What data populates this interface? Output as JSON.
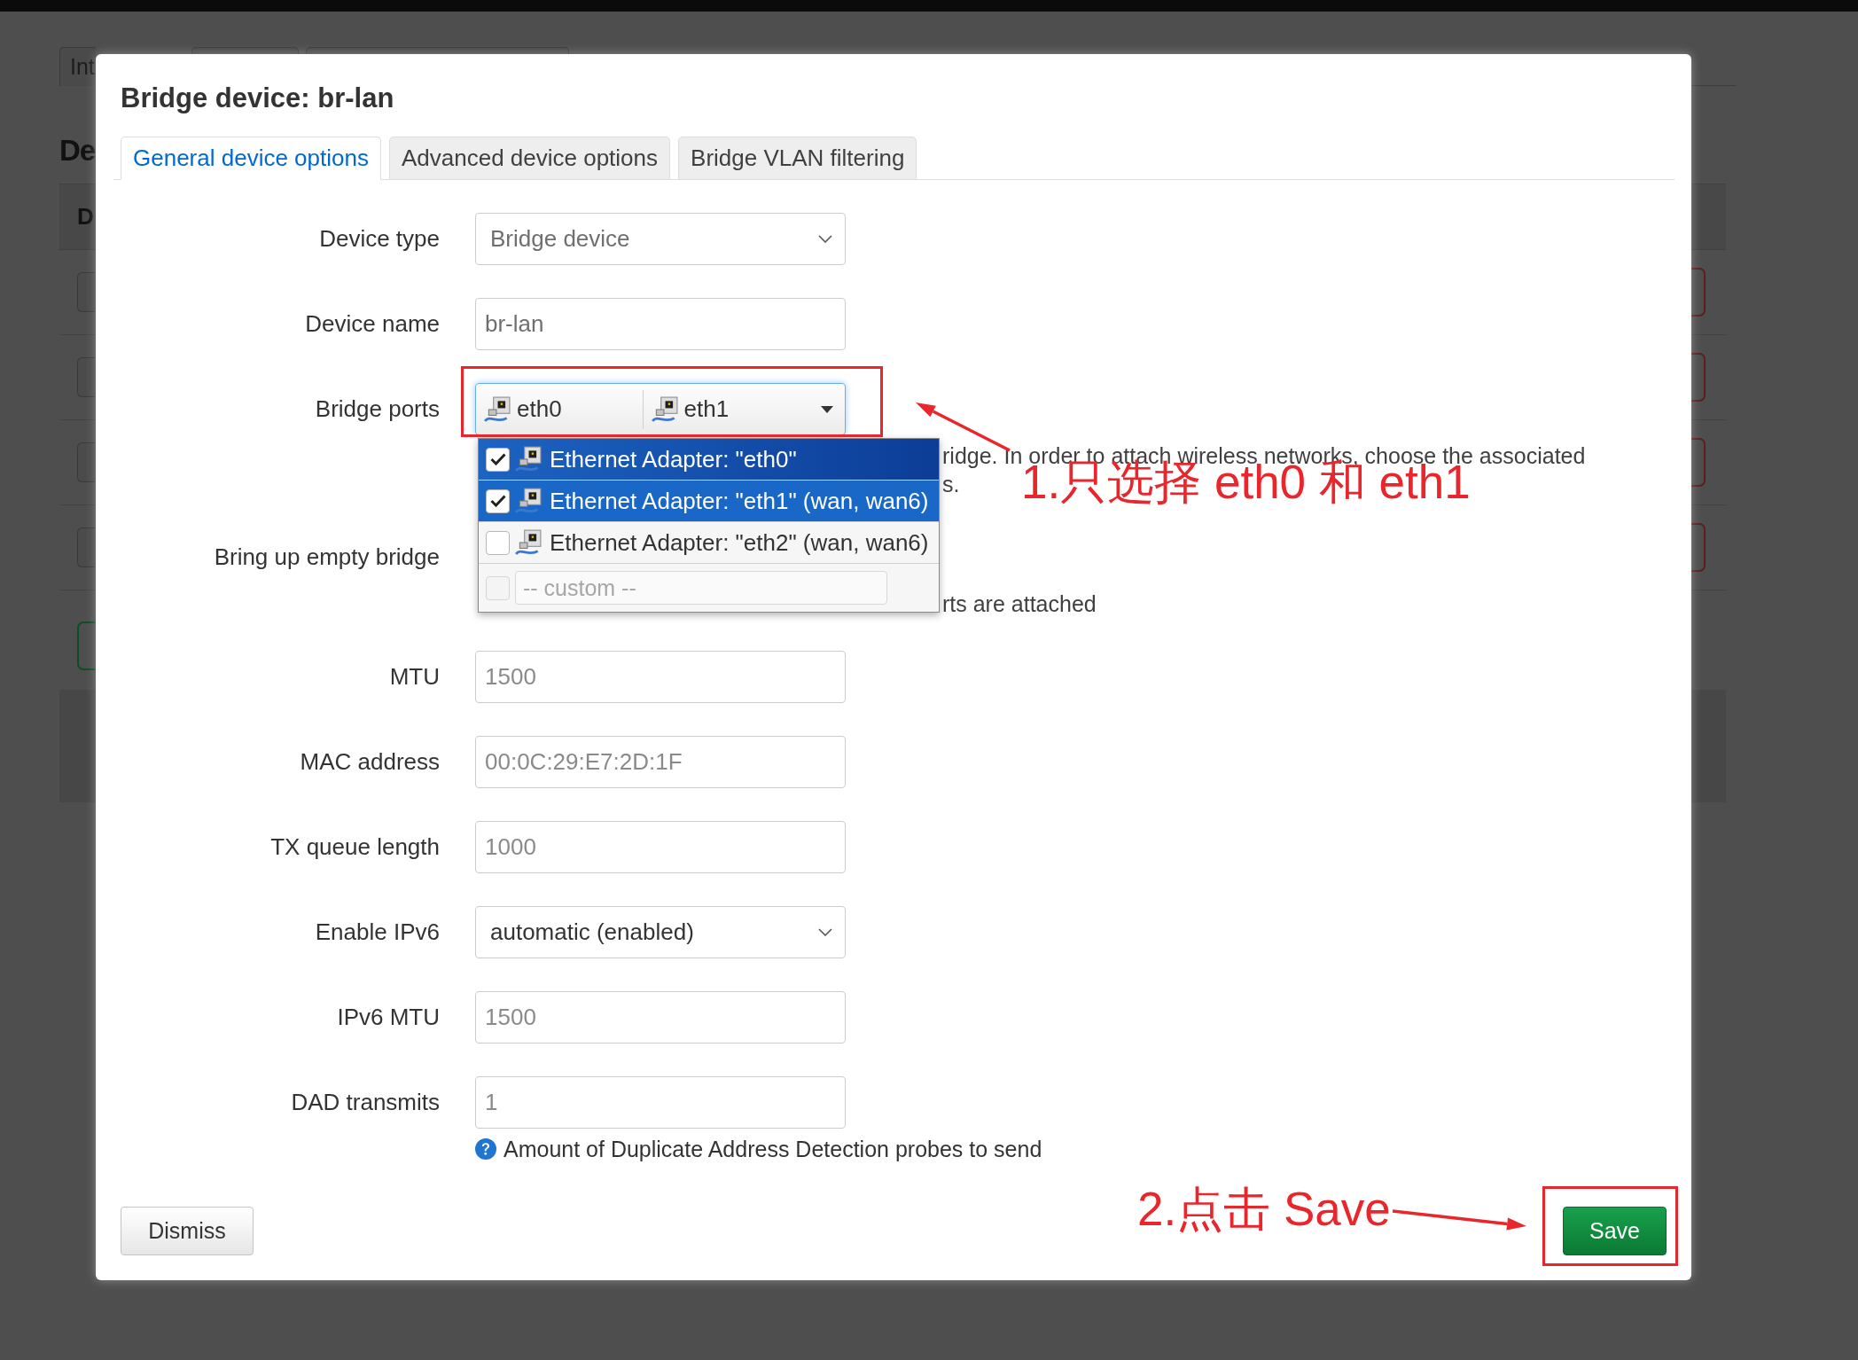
{
  "background_page": {
    "tabs": [
      {
        "label": "Int",
        "covered": false
      },
      {
        "covered": true
      },
      {
        "covered": true
      }
    ],
    "heading": "De",
    "table": {
      "header": "D",
      "rows": [
        {
          "kind": "device"
        },
        {
          "kind": "device"
        },
        {
          "kind": "device"
        },
        {
          "kind": "device"
        }
      ]
    }
  },
  "dialog": {
    "title": "Bridge device: br-lan",
    "tabs": [
      {
        "label": "General device options",
        "selected": true
      },
      {
        "label": "Advanced device options",
        "selected": false
      },
      {
        "label": "Bridge VLAN filtering",
        "selected": false
      }
    ],
    "fields": [
      {
        "label": "Device type",
        "kind": "select",
        "value": "Bridge device",
        "disabled": true
      },
      {
        "label": "Device name",
        "kind": "text",
        "value": "br-lan",
        "disabled": true
      },
      {
        "label": "Bridge ports",
        "kind": "multiselect",
        "focused": true,
        "chips": [
          "eth0",
          "eth1"
        ],
        "description": [
          "ridge. In order to attach wireless networks, choose the associated",
          "s."
        ]
      },
      {
        "label": "Bring up empty bridge",
        "kind": "covered",
        "description": [
          "rts are attached"
        ]
      },
      {
        "label": "MTU",
        "kind": "text",
        "placeholder": "1500"
      },
      {
        "label": "MAC address",
        "kind": "text",
        "placeholder": "00:0C:29:E7:2D:1F"
      },
      {
        "label": "TX queue length",
        "kind": "text",
        "placeholder": "1000"
      },
      {
        "label": "Enable IPv6",
        "kind": "select",
        "value": "automatic (enabled)",
        "disabled": false
      },
      {
        "label": "IPv6 MTU",
        "kind": "text",
        "placeholder": "1500"
      },
      {
        "label": "DAD transmits",
        "kind": "text",
        "placeholder": "1",
        "help": "Amount of Duplicate Address Detection probes to send"
      }
    ],
    "dropdown": {
      "options": [
        {
          "label": "Ethernet Adapter: \"eth0\"",
          "checked": true,
          "focused": true
        },
        {
          "label": "Ethernet Adapter: \"eth1\" (wan, wan6)",
          "checked": true,
          "focused": false
        },
        {
          "label": "Ethernet Adapter: \"eth2\" (wan, wan6)",
          "checked": false,
          "focused": false
        }
      ],
      "custom": {
        "placeholder": "-- custom --",
        "checked": false
      }
    },
    "buttons": {
      "dismiss": "Dismiss",
      "save": "Save"
    }
  },
  "annotations": [
    {
      "text": "1.只选择 eth0 和 eth1"
    },
    {
      "text": "2.点击 Save"
    }
  ]
}
